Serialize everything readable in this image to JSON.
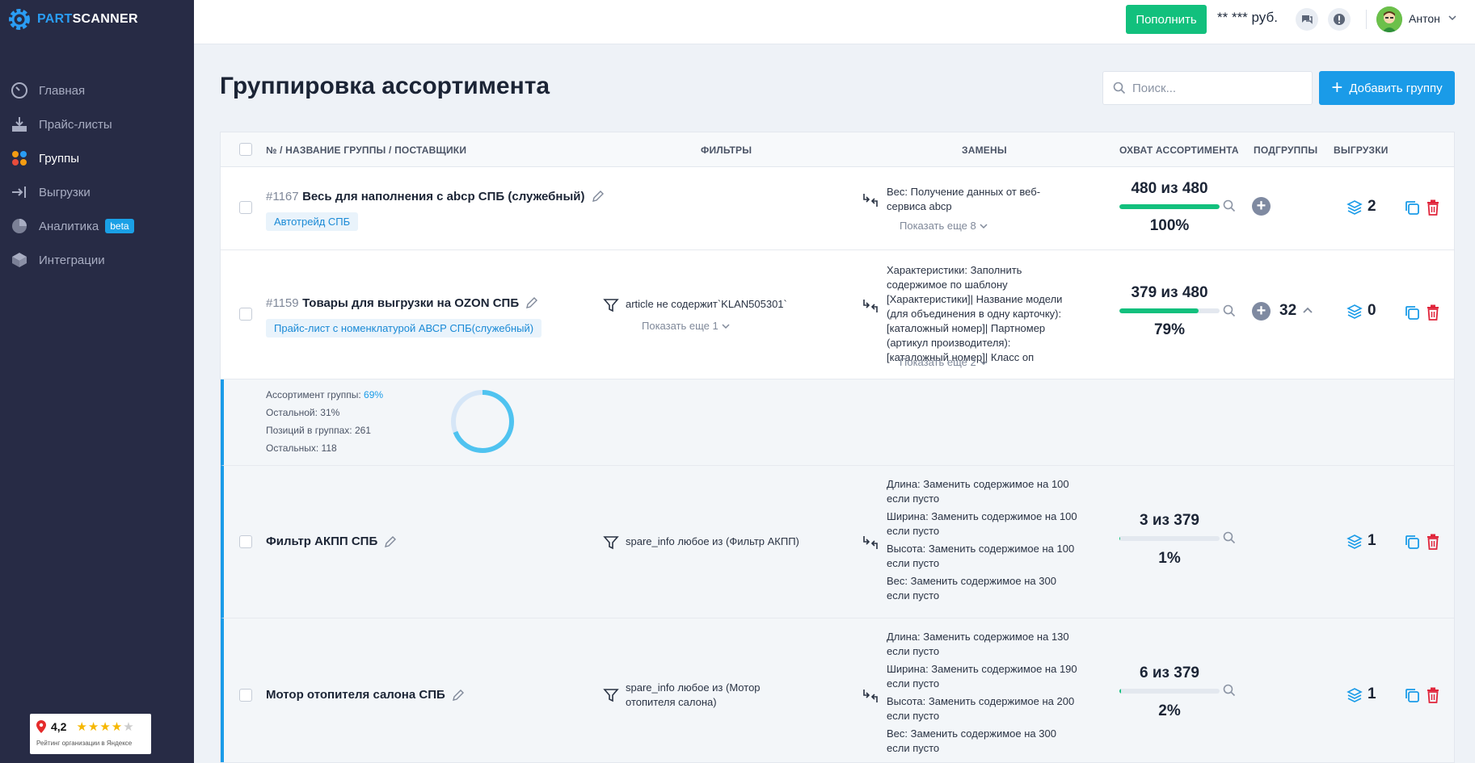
{
  "app": {
    "logo_part1": "PART",
    "logo_part2": "SCANNER"
  },
  "sidebar": {
    "items": [
      {
        "label": "Главная",
        "icon": "speedometer-icon"
      },
      {
        "label": "Прайс-листы",
        "icon": "download-tray-icon"
      },
      {
        "label": "Группы",
        "icon": "dots-grid-icon"
      },
      {
        "label": "Выгрузки",
        "icon": "export-arrow-icon"
      },
      {
        "label": "Аналитика",
        "icon": "pie-chart-icon",
        "badge": "beta"
      },
      {
        "label": "Интеграции",
        "icon": "cube-icon"
      }
    ]
  },
  "rating": {
    "value": "4,2",
    "caption": "Рейтинг организации в Яндексе",
    "stars_filled": 4
  },
  "topbar": {
    "topup_label": "Пополнить",
    "balance": "** *** руб.",
    "user_name": "Антон"
  },
  "header": {
    "title": "Группировка ассортимента",
    "search_placeholder": "Поиск...",
    "add_label": "Добавить группу"
  },
  "table": {
    "columns": {
      "name": "№ / НАЗВАНИЕ ГРУППЫ / ПОСТАВЩИКИ",
      "filters": "ФИЛЬТРЫ",
      "replacements": "ЗАМЕНЫ",
      "coverage": "ОХВАТ АССОРТИМЕНТА",
      "subgroups": "ПОДГРУППЫ",
      "exports": "ВЫГРУЗКИ"
    },
    "rows": [
      {
        "num": "#1167",
        "name": "Весь для наполнения с abcp СПБ (служебный)",
        "supplier": "Автотрейд СПБ",
        "replacements": [
          "Вес: Получение данных от веб-сервиса abcp"
        ],
        "replacements_more": "Показать еще 8",
        "coverage_count": "480 из 480",
        "coverage_pct": "100%",
        "coverage_fraction": 1.0,
        "exports": "2"
      },
      {
        "num": "#1159",
        "name": "Товары для выгрузки на OZON СПБ",
        "supplier": "Прайс-лист с номенклатурой АВСР СПБ(служебный)",
        "filter": "article не содержит`KLAN505301`",
        "filter_more": "Показать еще 1",
        "replacements": [
          "Характеристики: Заполнить содержимое по шаблону [Характеристики]| Название модели (для объединения в одну карточку): [каталожный номер]| Партномер (артикул производителя): [каталожный номер]| Класс оп"
        ],
        "replacements_more": "Показать еще 2",
        "coverage_count": "379 из 480",
        "coverage_pct": "79%",
        "coverage_fraction": 0.79,
        "subgroups": "32",
        "exports": "0"
      }
    ],
    "stats": {
      "assortment_label": "Ассортимент группы:",
      "assortment_value": "69%",
      "assortment_fraction": 0.69,
      "other_label": "Остальной: 31%",
      "positions_label": "Позиций в группах: 261",
      "others_label": "Остальных: 118"
    },
    "subrows": [
      {
        "name": "Фильтр АКПП СПБ",
        "filter": "spare_info любое из (Фильтр АКПП)",
        "replacements": [
          "Длина: Заменить содержимое на 100 если пусто",
          "Ширина: Заменить содержимое на 100 если пусто",
          "Высота: Заменить содержимое на 100 если пусто",
          "Вес: Заменить содержимое на 300 если пусто"
        ],
        "coverage_count": "3 из 379",
        "coverage_pct": "1%",
        "coverage_fraction": 0.01,
        "exports": "1"
      },
      {
        "name": "Мотор отопителя салона СПБ",
        "filter": "spare_info любое из (Мотор отопителя салона)",
        "replacements": [
          "Длина: Заменить содержимое на 130 если пусто",
          "Ширина: Заменить содержимое на 190 если пусто",
          "Высота: Заменить содержимое на 200 если пусто",
          "Вес: Заменить содержимое на 300 если пусто"
        ],
        "coverage_count": "6 из 379",
        "coverage_pct": "2%",
        "coverage_fraction": 0.02,
        "exports": "1"
      }
    ]
  },
  "colors": {
    "sidebar": "#272b45",
    "accent": "#1a9be8",
    "success": "#12c07d",
    "danger": "#e0253b"
  }
}
